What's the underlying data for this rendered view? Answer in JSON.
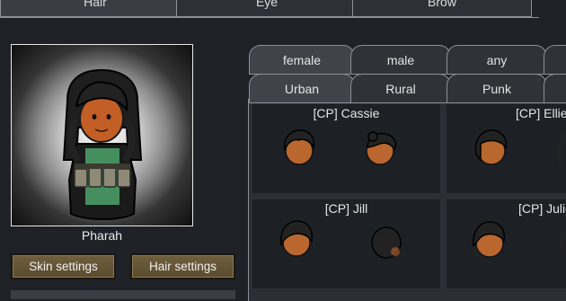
{
  "top_tabs": [
    {
      "label": "Hair",
      "active": true
    },
    {
      "label": "Eye",
      "active": false
    },
    {
      "label": "Brow",
      "active": false
    }
  ],
  "pawn": {
    "name": "Pharah"
  },
  "buttons": {
    "skin": "Skin settings",
    "hair": "Hair settings"
  },
  "gender_tabs": [
    {
      "label": "female",
      "active": true
    },
    {
      "label": "male",
      "active": false
    },
    {
      "label": "any",
      "active": false
    }
  ],
  "style_tabs": [
    {
      "label": "Urban",
      "active": true
    },
    {
      "label": "Rural",
      "active": false
    },
    {
      "label": "Punk",
      "active": false
    }
  ],
  "hair_options": [
    {
      "name": "[CP] Cassie"
    },
    {
      "name": "[CP] Ellie"
    },
    {
      "name": "[CP] Jill"
    },
    {
      "name": "[CP] Julie"
    }
  ],
  "colors": {
    "skin": "#b9662f",
    "hair": "#222222",
    "button": "#6f5f3e"
  }
}
